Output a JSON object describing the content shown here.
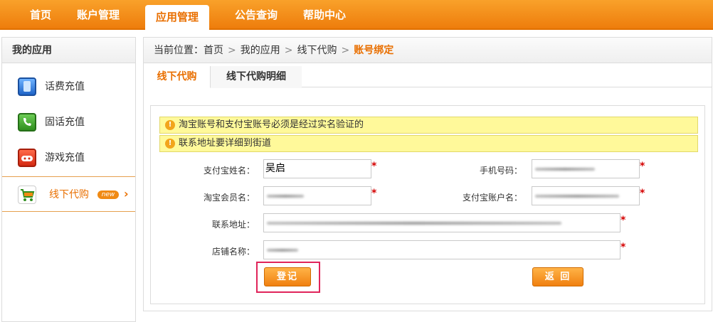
{
  "topnav": {
    "items": [
      {
        "label": "首页"
      },
      {
        "label": "账户管理"
      },
      {
        "label": "应用管理",
        "active": true
      },
      {
        "label": "公告查询"
      },
      {
        "label": "帮助中心"
      }
    ]
  },
  "sidebar": {
    "title": "我的应用",
    "items": [
      {
        "label": "话费充值",
        "icon": "mobile-phone-icon"
      },
      {
        "label": "固话充值",
        "icon": "telephone-icon"
      },
      {
        "label": "游戏充值",
        "icon": "gamepad-icon"
      },
      {
        "label": "线下代购",
        "icon": "shopping-cart-icon",
        "badge": "new",
        "active": true
      }
    ]
  },
  "breadcrumb": {
    "prefix": "当前位置：",
    "items": [
      "首页",
      "我的应用",
      "线下代购"
    ],
    "current": "账号绑定"
  },
  "tabs": [
    {
      "label": "线下代购",
      "active": true
    },
    {
      "label": "线下代购明细"
    }
  ],
  "notices": [
    "淘宝账号和支付宝账号必须是经过实名验证的",
    "联系地址要详细到街道"
  ],
  "form": {
    "alipay_name_label": "支付宝姓名：",
    "alipay_name_value": "吴启",
    "mobile_label": "手机号码：",
    "taobao_member_label": "淘宝会员名：",
    "alipay_account_label": "支付宝账户名：",
    "address_label": "联系地址：",
    "shop_name_label": "店铺名称：",
    "required_mark": "*"
  },
  "buttons": {
    "register": "登记",
    "back": "返 回"
  },
  "colors": {
    "accent": "#ee7d0c",
    "notice_bg": "#fff99a",
    "required": "#d40000",
    "highlight": "#e0245a"
  }
}
